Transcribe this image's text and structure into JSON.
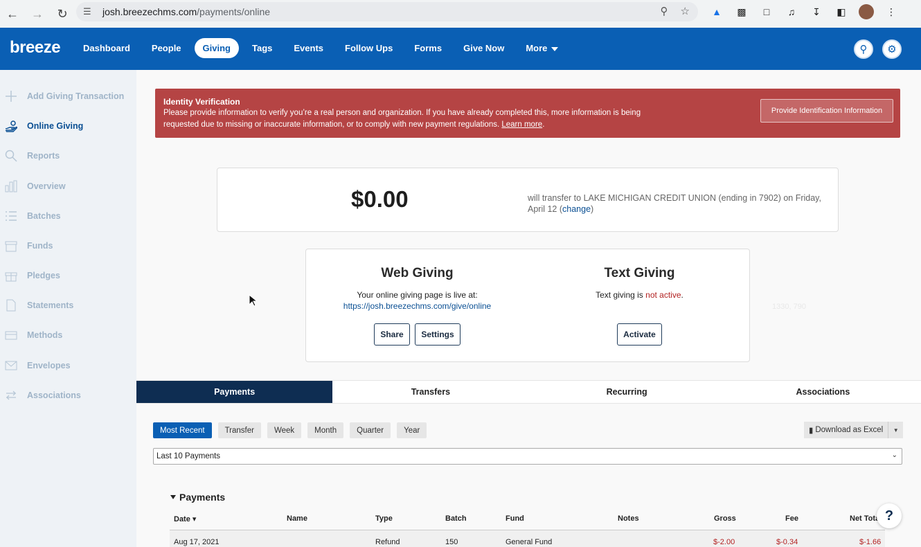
{
  "browser": {
    "url_host": "josh.breezechms.com",
    "url_path": "/payments/online"
  },
  "app": {
    "logo": "breeze",
    "nav": [
      {
        "label": "Dashboard"
      },
      {
        "label": "People"
      },
      {
        "label": "Giving",
        "active": true
      },
      {
        "label": "Tags"
      },
      {
        "label": "Events"
      },
      {
        "label": "Follow Ups"
      },
      {
        "label": "Forms"
      },
      {
        "label": "Give Now"
      },
      {
        "label": "More"
      }
    ]
  },
  "sidebar": {
    "items": [
      {
        "label": "Add Giving Transaction",
        "icon": "plus-icon"
      },
      {
        "label": "Online Giving",
        "icon": "hand-icon",
        "active": true
      },
      {
        "label": "Reports",
        "icon": "search-icon"
      },
      {
        "label": "Overview",
        "icon": "bar-chart-icon"
      },
      {
        "label": "Batches",
        "icon": "list-icon"
      },
      {
        "label": "Funds",
        "icon": "box-icon"
      },
      {
        "label": "Pledges",
        "icon": "gift-icon"
      },
      {
        "label": "Statements",
        "icon": "document-icon"
      },
      {
        "label": "Methods",
        "icon": "card-icon"
      },
      {
        "label": "Envelopes",
        "icon": "envelope-icon"
      },
      {
        "label": "Associations",
        "icon": "arrows-icon"
      }
    ]
  },
  "alert": {
    "title": "Identity Verification",
    "message": "Please provide information to verify you’re a real person and organization. If you have already completed this, more information is being requested due to missing or inaccurate information, or to comply with new payment regulations.",
    "link": "Learn more",
    "button": "Provide Identification Information"
  },
  "balance": {
    "amount": "$0.00",
    "description": "will transfer to LAKE MICHIGAN CREDIT UNION (ending in 7902) on Friday, April 12",
    "change_link": "change"
  },
  "web_giving": {
    "title": "Web Giving",
    "text": "Your online giving page is live at:",
    "link": "https://josh.breezechms.com/give/online",
    "share": "Share",
    "settings": "Settings"
  },
  "text_giving": {
    "title": "Text Giving",
    "text": "Text giving is",
    "status": "not active",
    "activate": "Activate"
  },
  "overlay_coords": "1330, 790",
  "tabs": [
    "Payments",
    "Transfers",
    "Recurring",
    "Associations"
  ],
  "filters": [
    "Most Recent",
    "Transfer",
    "Week",
    "Month",
    "Quarter",
    "Year"
  ],
  "download": "Download as Excel",
  "select_value": "Last 10 Payments",
  "table": {
    "section": "Payments",
    "headers": [
      "Date",
      "Name",
      "Type",
      "Batch",
      "Fund",
      "Notes",
      "Gross",
      "Fee",
      "Net Tota"
    ],
    "rows": [
      {
        "date": "Aug 17, 2021",
        "name": "",
        "type": "Refund",
        "batch": "150",
        "fund": "General Fund",
        "notes": "",
        "gross": "$-2.00",
        "fee": "$-0.34",
        "net": "$-1.66"
      }
    ]
  },
  "help": "?"
}
